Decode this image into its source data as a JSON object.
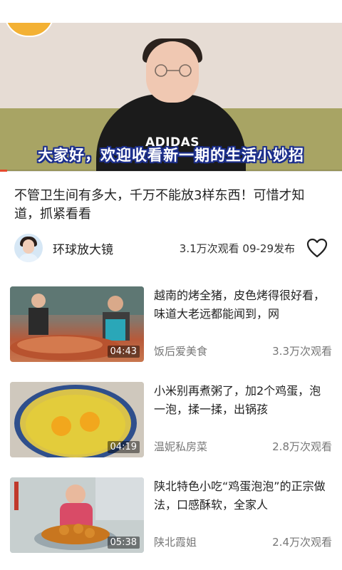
{
  "player": {
    "subtitle": "大家好，欢迎收看新一期的生活小妙招",
    "shirt_text": "ADIDAS",
    "progress": 0.02,
    "progress_color": "#e64a2e"
  },
  "video": {
    "title": "不管卫生间有多大，千万不能放3样东西！可惜才知道，抓紧看看",
    "author": "环球放大镜",
    "stats": "3.1万次观看 09-29发布",
    "like_icon": "heart-outline-icon"
  },
  "recommendations": [
    {
      "title": "越南的烤全猪，皮色烤得很好看，味道大老远都能闻到，网",
      "duration": "04:43",
      "channel": "饭后爱美食",
      "views": "3.3万次观看"
    },
    {
      "title": "小米别再煮粥了，加2个鸡蛋，泡一泡，揉一揉，出锅孩",
      "duration": "04:19",
      "channel": "温妮私房菜",
      "views": "2.8万次观看"
    },
    {
      "title": "陕北特色小吃“鸡蛋泡泡”的正宗做法，口感酥软，全家人",
      "duration": "05:38",
      "channel": "陕北霞姐",
      "views": "2.4万次观看"
    }
  ]
}
